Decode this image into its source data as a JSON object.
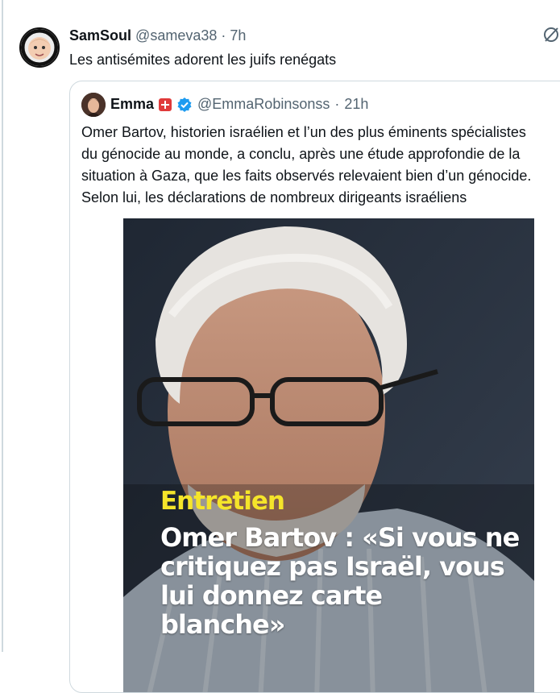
{
  "tweet": {
    "display_name": "SamSoul",
    "handle": "@sameva38",
    "separator": "·",
    "time": "7h",
    "text": "Les antisémites adorent les juifs renégats"
  },
  "quote": {
    "display_name": "Emma",
    "handle": "@EmmaRobinsonss",
    "separator": "·",
    "time": "21h",
    "text_lines": [
      "Omer Bartov, historien israélien et l’un des plus éminents spécialistes",
      "du génocide au monde, a conclu, après une étude approfondie de la",
      "situation à Gaza, que les faits observés relevaient bien d’un génocide.",
      "Selon lui, les déclarations de nombreux dirigeants israéliens"
    ],
    "media": {
      "kicker": "Entretien",
      "title_lines": [
        "Omer Bartov : «Si vous ne",
        "critiquez pas Israël, vous",
        "lui donnez carte",
        "blanche»"
      ]
    }
  },
  "colors": {
    "accent": "#1d9bf0",
    "kicker": "#f5e52a",
    "muted": "#536471",
    "border": "#cfd9de"
  },
  "icons": {
    "more": "grok-icon",
    "verified": "verified-badge-icon",
    "flag": "swiss-flag-icon"
  }
}
